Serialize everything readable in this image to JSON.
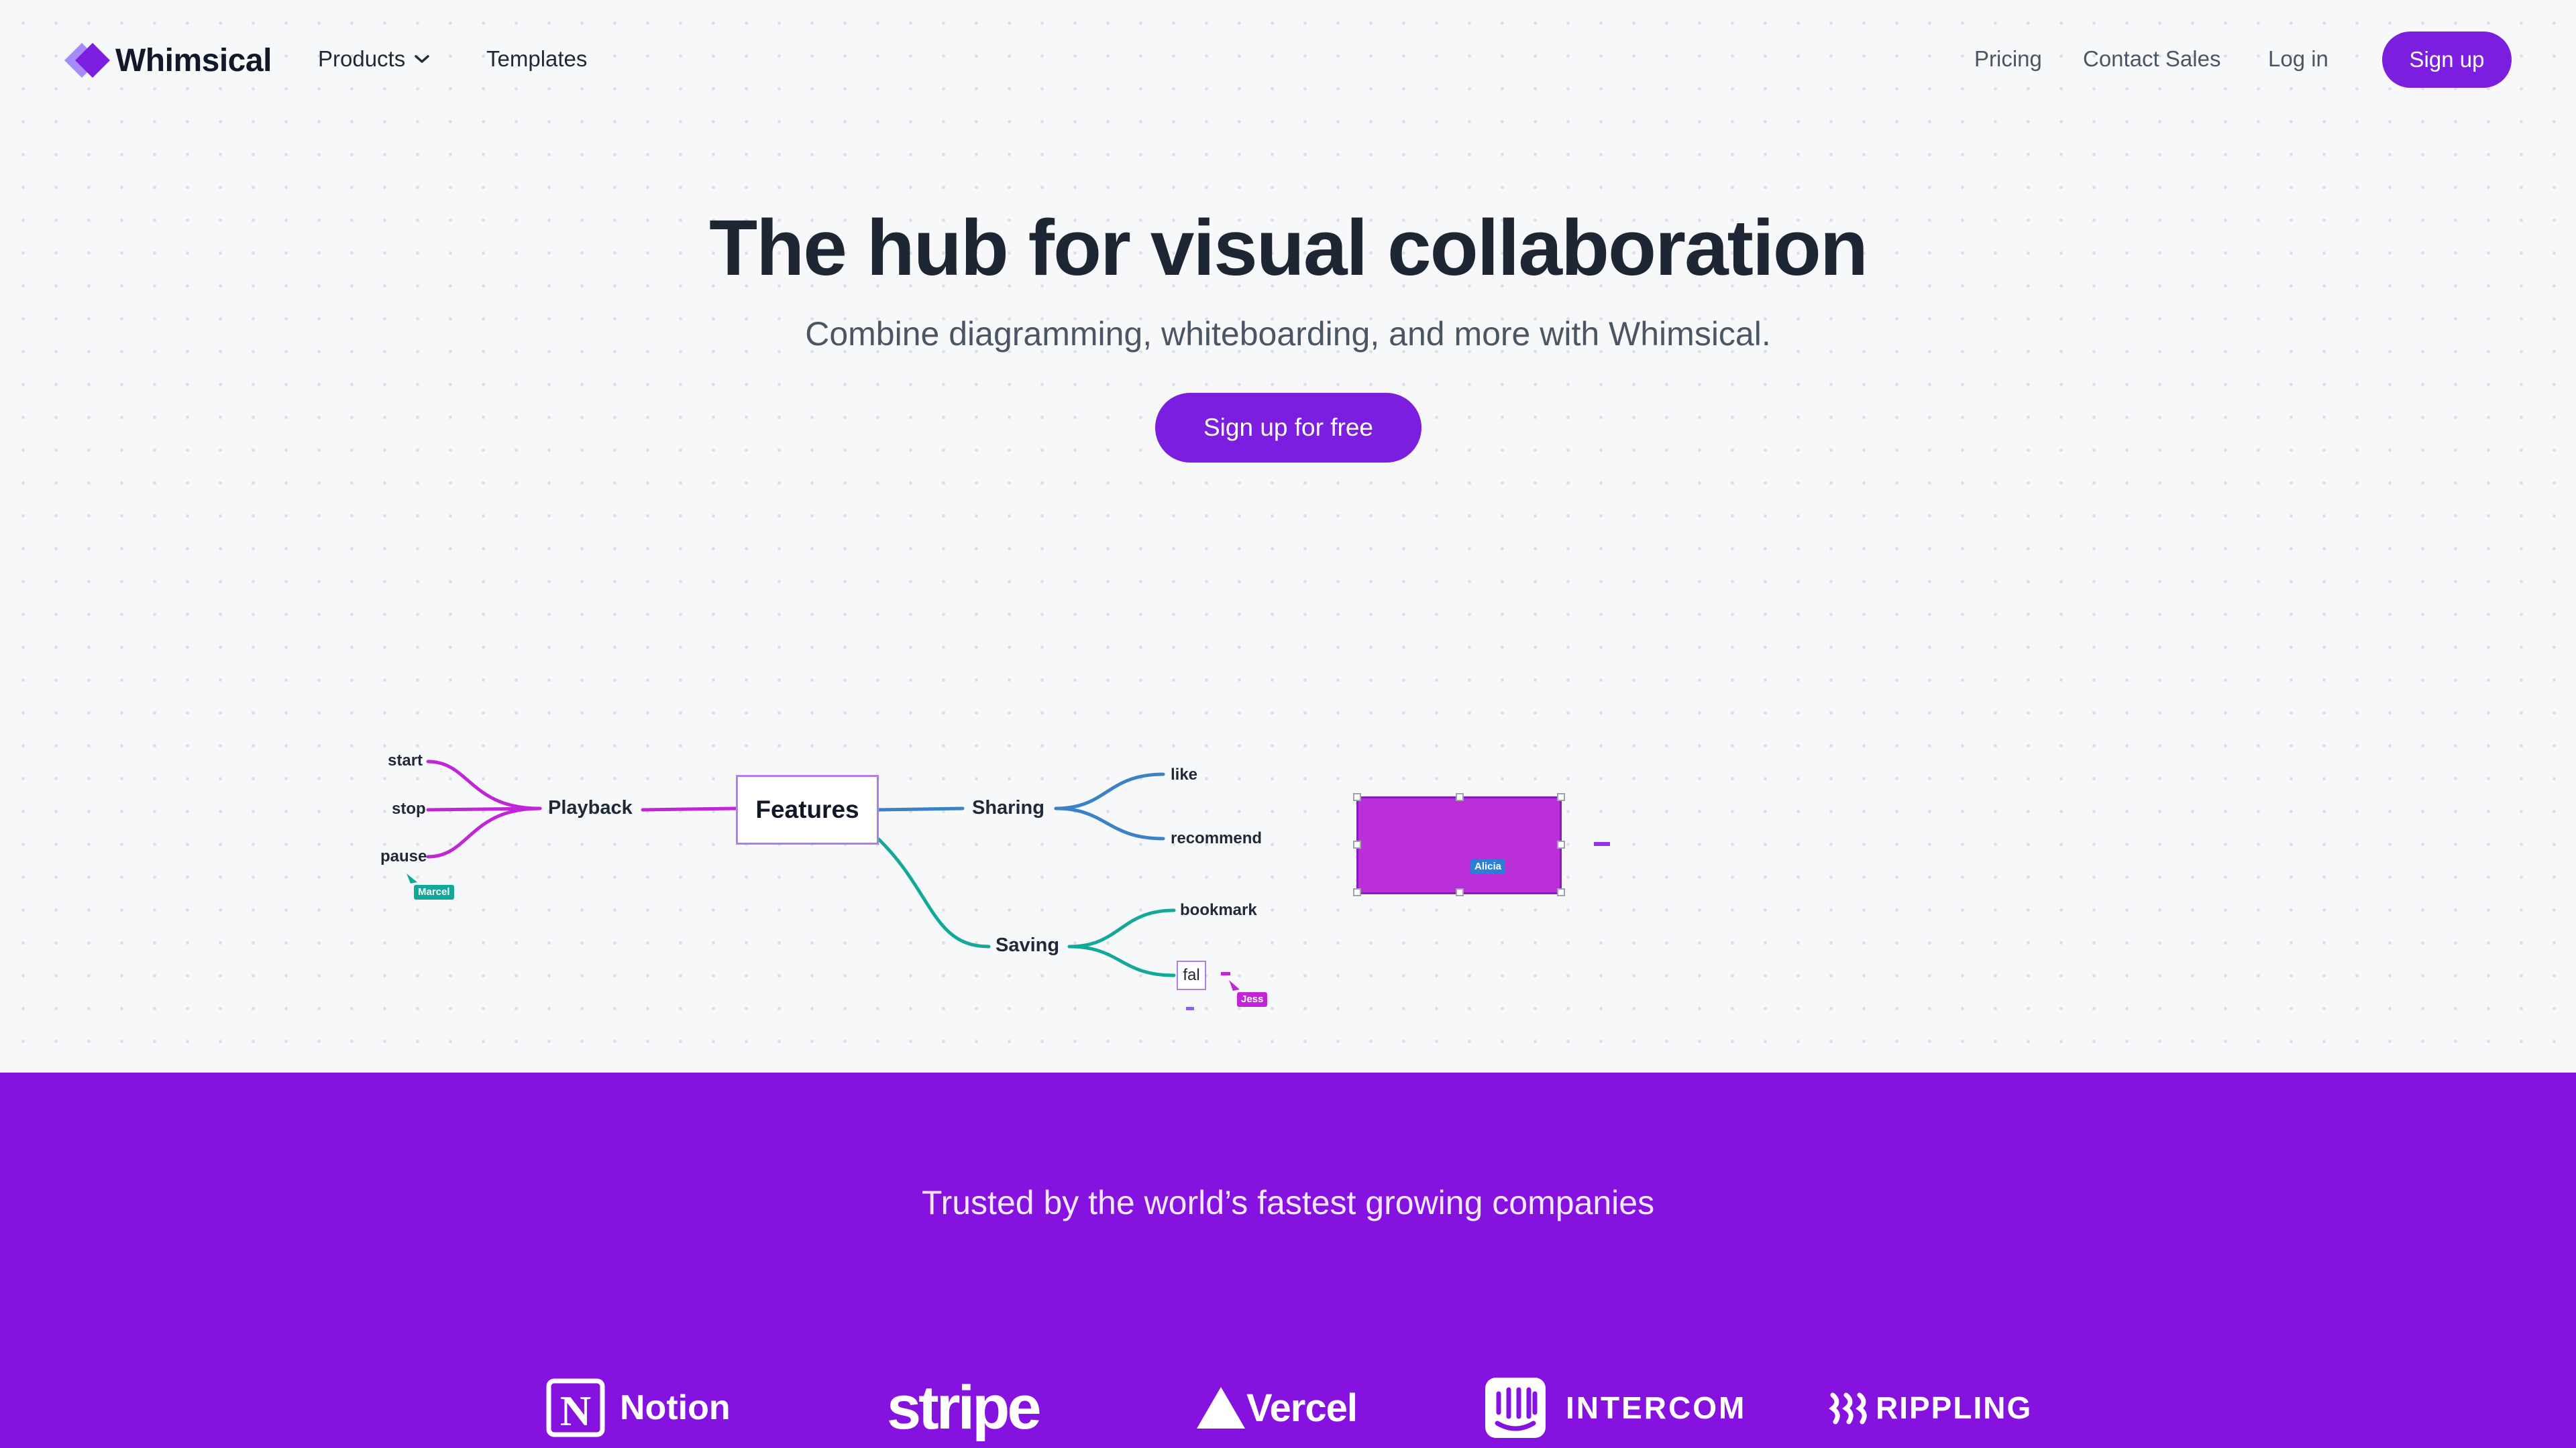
{
  "nav": {
    "brand": "Whimsical",
    "products": "Products",
    "templates": "Templates",
    "pricing": "Pricing",
    "contact_sales": "Contact Sales",
    "login": "Log in",
    "signup": "Sign up"
  },
  "hero": {
    "title": "The hub for visual collaboration",
    "subtitle": "Combine diagramming, whiteboarding, and more with Whimsical.",
    "cta": "Sign up for free"
  },
  "mindmap": {
    "root": "Features",
    "playback": {
      "label": "Playback",
      "children": [
        "start",
        "stop",
        "pause"
      ]
    },
    "sharing": {
      "label": "Sharing",
      "children": [
        "like",
        "recommend"
      ]
    },
    "saving": {
      "label": "Saving",
      "children": [
        "bookmark",
        "fal"
      ]
    },
    "cursors": [
      "Marcel",
      "Jess",
      "Alicia"
    ],
    "colors": {
      "playback": "#c026d3",
      "sharing": "#3b82c4",
      "saving": "#14a89a",
      "selection": "#bb2fd8"
    }
  },
  "trusted": {
    "title": "Trusted by the world’s fastest growing companies",
    "logos": [
      "Notion",
      "stripe",
      "Vercel",
      "INTERCOM",
      "RIPPLING"
    ]
  },
  "colors": {
    "brand": "#7c1ee0",
    "band": "#8612e0"
  }
}
